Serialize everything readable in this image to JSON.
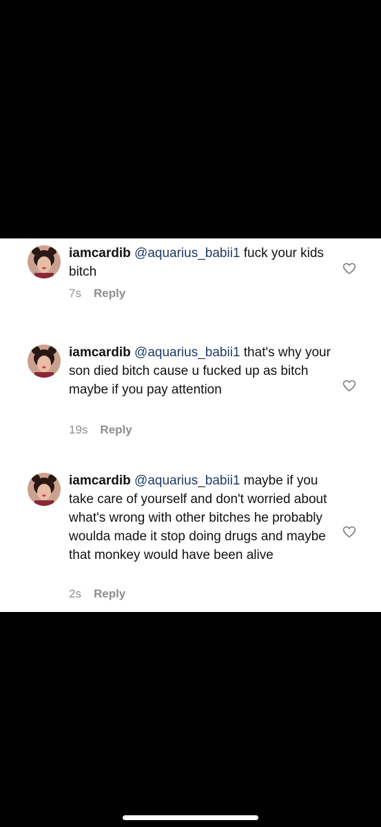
{
  "comments": [
    {
      "username": "iamcardib",
      "mention": "@aquarius_babii1",
      "text": " fuck your kids bitch",
      "time": "7s",
      "reply_label": "Reply"
    },
    {
      "username": "iamcardib",
      "mention": "@aquarius_babii1",
      "text": " that's why your son died bitch cause u fucked up as bitch maybe if you pay attention",
      "time": "19s",
      "reply_label": "Reply"
    },
    {
      "username": "iamcardib",
      "mention": "@aquarius_babii1",
      "text": " maybe if you take care of yourself and don't worried about what's wrong with other bitches he probably woulda made it stop doing drugs and maybe that monkey would have been alive",
      "time": "2s",
      "reply_label": "Reply"
    }
  ],
  "icons": {
    "like": "heart-outline-icon",
    "avatar": "profile-avatar"
  },
  "colors": {
    "mention": "#1f3a66",
    "meta": "#8e8e8e",
    "background": "#ffffff"
  }
}
